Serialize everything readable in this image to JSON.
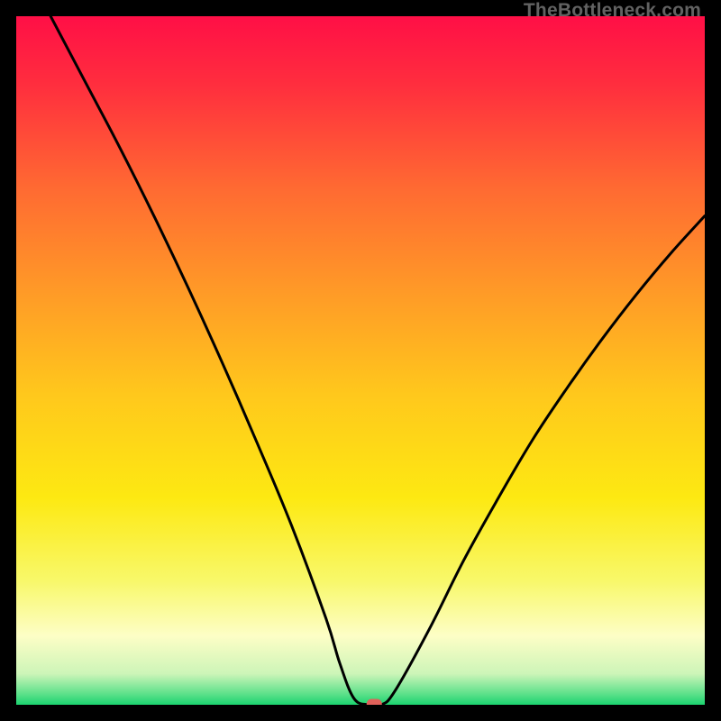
{
  "watermark": "TheBottleneck.com",
  "chart_data": {
    "type": "line",
    "title": "",
    "xlabel": "",
    "ylabel": "",
    "xlim": [
      0,
      100
    ],
    "ylim": [
      0,
      100
    ],
    "x": [
      5,
      10,
      15,
      20,
      25,
      30,
      35,
      40,
      45,
      47,
      49,
      51,
      53,
      55,
      60,
      65,
      70,
      75,
      80,
      85,
      90,
      95,
      100
    ],
    "values": [
      100,
      90.5,
      81,
      71,
      60.5,
      49.5,
      38,
      26,
      12.5,
      6,
      1,
      0,
      0,
      2,
      11,
      21,
      30,
      38.5,
      46,
      53,
      59.5,
      65.5,
      71
    ],
    "grid": false,
    "legend": false,
    "marker": {
      "x": 52,
      "y": 0
    },
    "background_gradient": {
      "stops": [
        {
          "pos": 0.0,
          "color": "#ff0f46"
        },
        {
          "pos": 0.1,
          "color": "#ff2e3e"
        },
        {
          "pos": 0.25,
          "color": "#ff6a32"
        },
        {
          "pos": 0.4,
          "color": "#ff9a27"
        },
        {
          "pos": 0.55,
          "color": "#ffc81c"
        },
        {
          "pos": 0.7,
          "color": "#fde912"
        },
        {
          "pos": 0.82,
          "color": "#f8f86a"
        },
        {
          "pos": 0.9,
          "color": "#fdfec6"
        },
        {
          "pos": 0.955,
          "color": "#cdf5b8"
        },
        {
          "pos": 0.985,
          "color": "#5ae089"
        },
        {
          "pos": 1.0,
          "color": "#1bd36f"
        }
      ]
    }
  }
}
